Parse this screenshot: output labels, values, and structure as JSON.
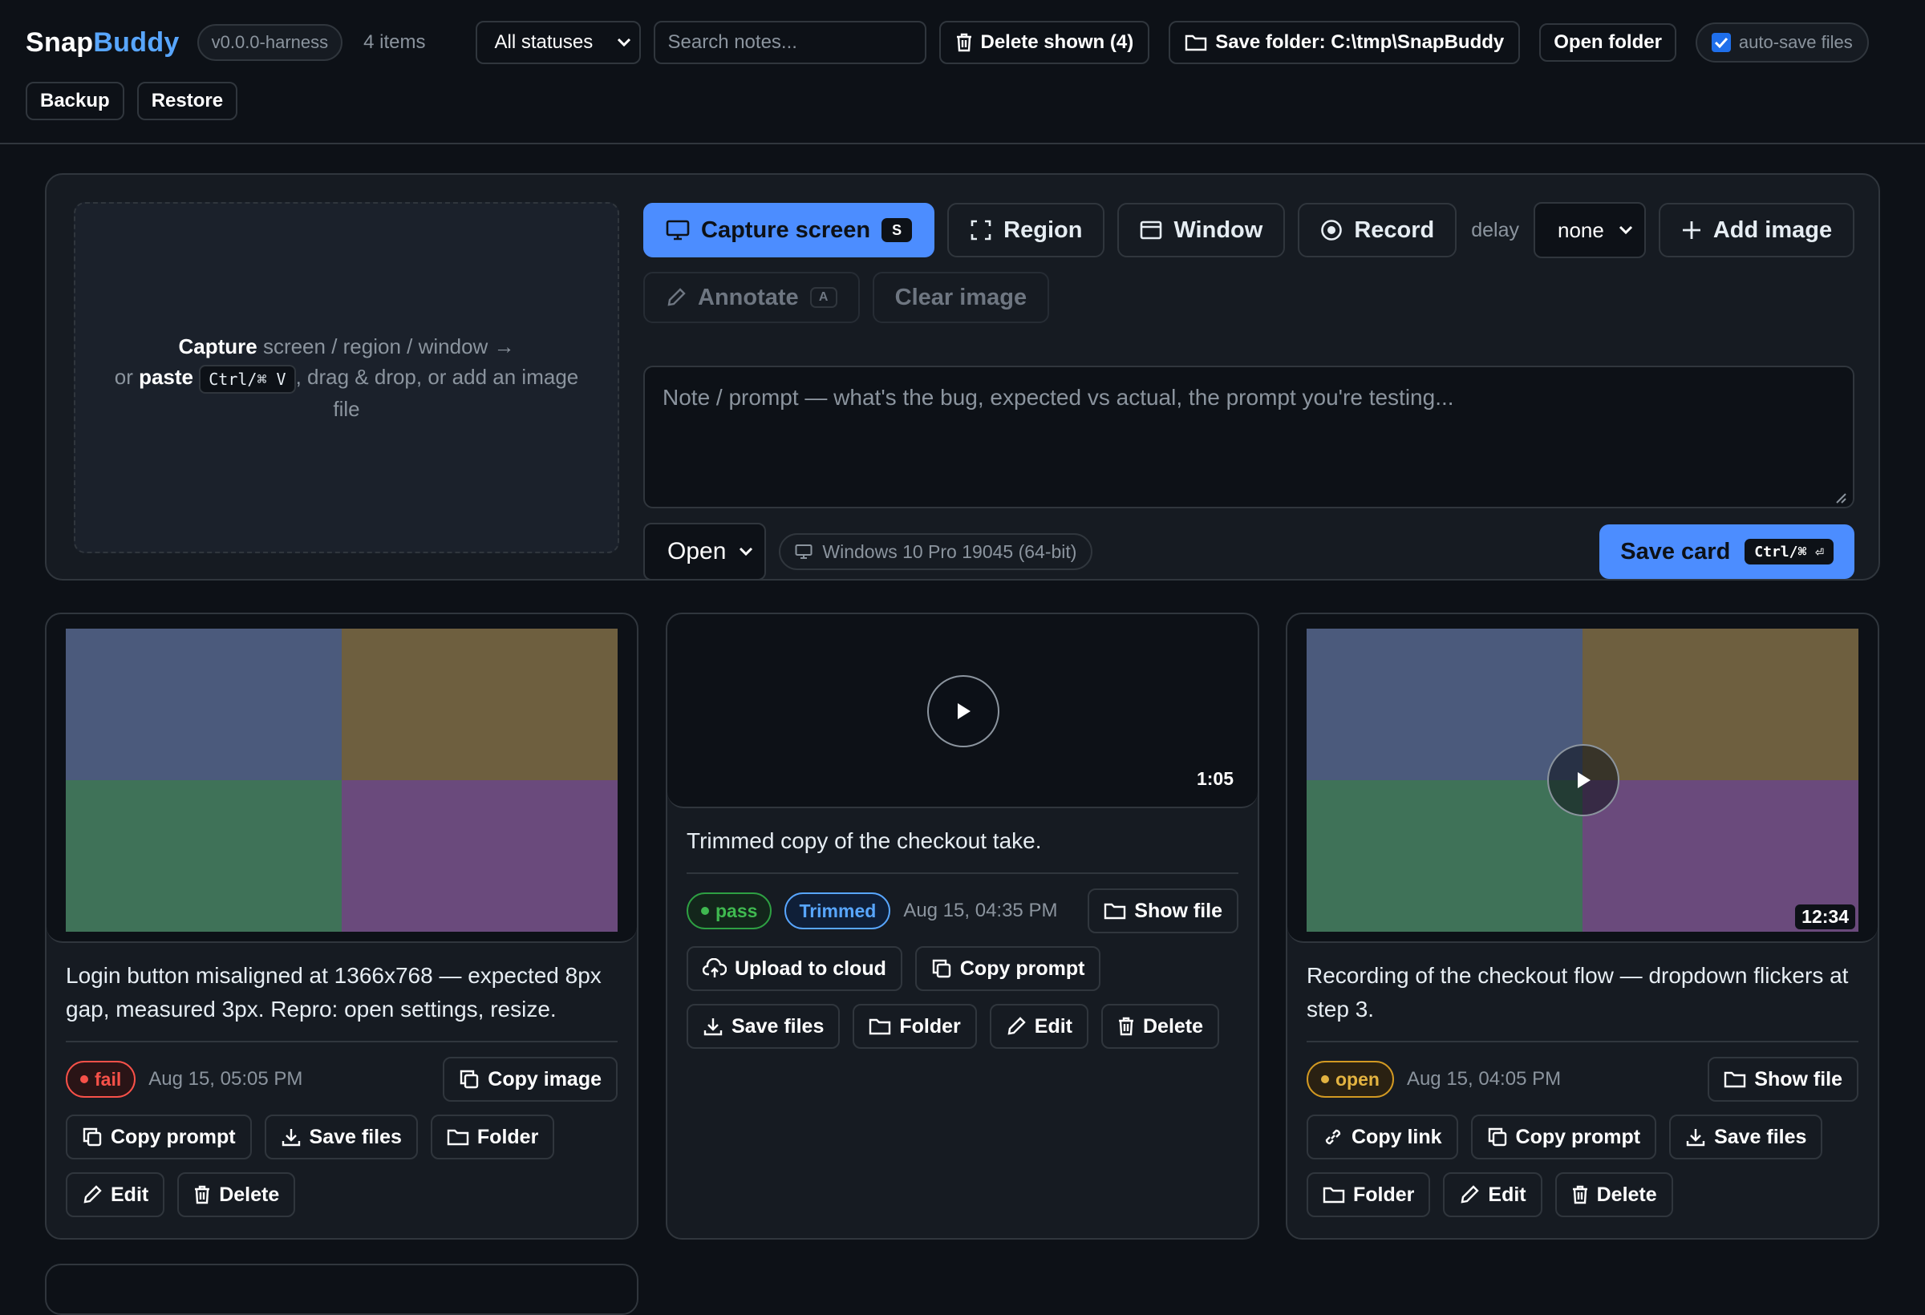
{
  "header": {
    "brand_a": "Snap",
    "brand_b": "Buddy",
    "version": "v0.0.0-harness",
    "item_count": "4 items",
    "status_filter": "All statuses",
    "search_placeholder": "Search notes...",
    "delete_shown": "Delete shown (4)",
    "save_folder": "Save folder: C:\\tmp\\SnapBuddy",
    "open_folder": "Open folder",
    "autosave_label": "auto-save files",
    "autosave_checked": true,
    "backup": "Backup",
    "restore": "Restore"
  },
  "capture": {
    "drop_strong_1": "Capture",
    "drop_text_1": " screen / region / window →",
    "drop_text_2a": "or ",
    "drop_strong_2": "paste",
    "drop_kbd": "Ctrl/⌘ V",
    "drop_text_2b": ", drag & drop, or add an image file",
    "capture_screen": "Capture screen",
    "capture_key": "S",
    "region": "Region",
    "window": "Window",
    "record": "Record",
    "delay_label": "delay",
    "delay_value": "none",
    "add_image": "Add image",
    "annotate": "Annotate",
    "annotate_key": "A",
    "clear_image": "Clear image",
    "note_placeholder": "Note / prompt — what's the bug, expected vs actual, the prompt you're testing...",
    "status_value": "Open",
    "os_label": "Windows 10 Pro 19045 (64-bit)",
    "save_card": "Save card",
    "save_key": "Ctrl/⌘ ⏎"
  },
  "cards": [
    {
      "description": "Login button misaligned at 1366x768 — expected 8px gap, measured 3px. Repro: open settings, resize.",
      "status": "fail",
      "timestamp": "Aug 15, 05:05 PM",
      "copy_image": "Copy image",
      "copy_prompt": "Copy prompt",
      "save_files": "Save files",
      "folder": "Folder",
      "edit": "Edit",
      "delete": "Delete"
    },
    {
      "duration": "1:05",
      "description": "Trimmed copy of the checkout take.",
      "status": "pass",
      "tag": "Trimmed",
      "timestamp": "Aug 15, 04:35 PM",
      "show_file": "Show file",
      "upload": "Upload to cloud",
      "copy_prompt": "Copy prompt",
      "save_files": "Save files",
      "folder": "Folder",
      "edit": "Edit",
      "delete": "Delete"
    },
    {
      "duration": "12:34",
      "description": "Recording of the checkout flow — dropdown flickers at step 3.",
      "status": "open",
      "timestamp": "Aug 15, 04:05 PM",
      "show_file": "Show file",
      "copy_link": "Copy link",
      "copy_prompt": "Copy prompt",
      "save_files": "Save files",
      "folder": "Folder",
      "edit": "Edit",
      "delete": "Delete"
    }
  ],
  "colors": {
    "background": "#0d1117",
    "panel": "#161b22",
    "border": "#30363d",
    "accent": "#4c8dff",
    "fail": "#f85149",
    "pass": "#3fb950",
    "open": "#e3b341"
  }
}
